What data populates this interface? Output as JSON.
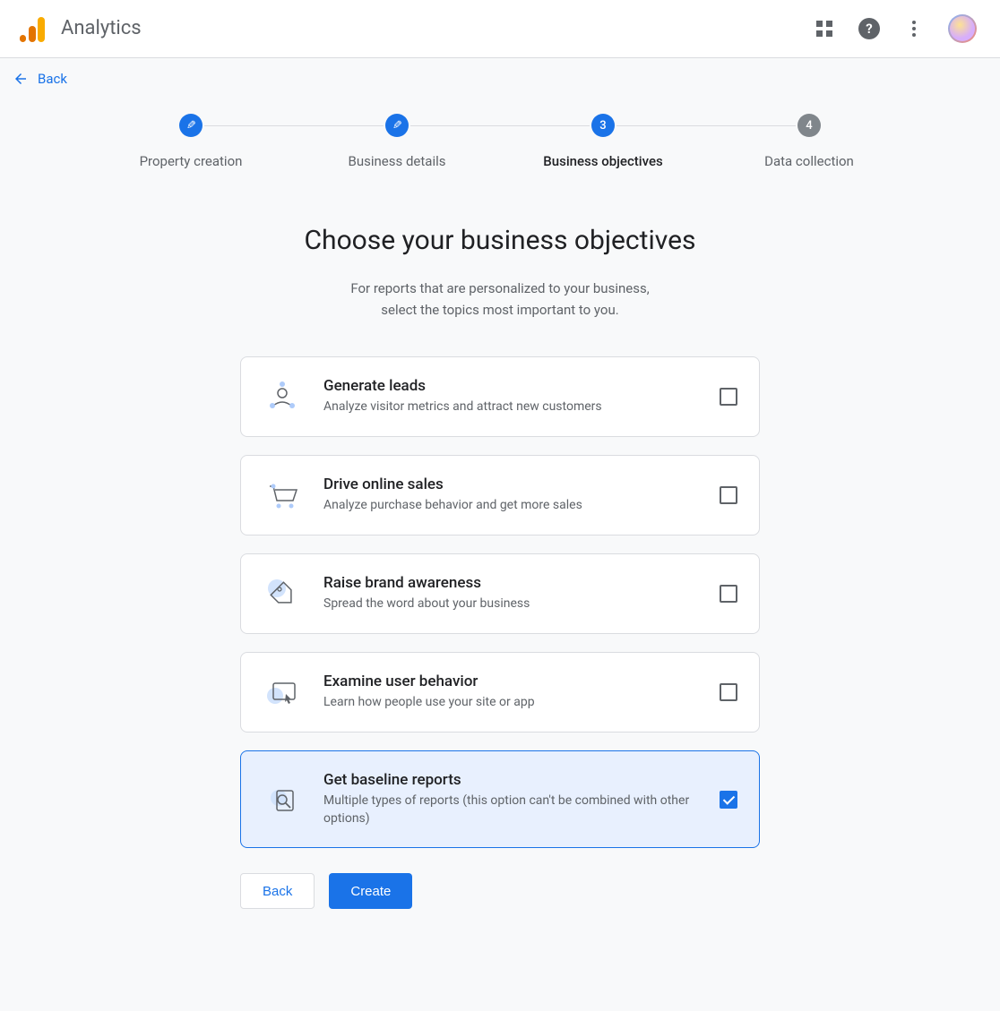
{
  "header": {
    "app_title": "Analytics",
    "back_label": "Back"
  },
  "stepper": {
    "steps": [
      {
        "label": "Property creation",
        "indicator": "✎",
        "state": "done"
      },
      {
        "label": "Business details",
        "indicator": "✎",
        "state": "done"
      },
      {
        "label": "Business objectives",
        "indicator": "3",
        "state": "active"
      },
      {
        "label": "Data collection",
        "indicator": "4",
        "state": "upcoming"
      }
    ]
  },
  "main": {
    "heading": "Choose your business objectives",
    "subtitle_line1": "For reports that are personalized to your business,",
    "subtitle_line2": "select the topics most important to you."
  },
  "objectives": [
    {
      "key": "generate-leads",
      "title": "Generate leads",
      "desc": "Analyze visitor metrics and attract new customers",
      "checked": false
    },
    {
      "key": "drive-online-sales",
      "title": "Drive online sales",
      "desc": "Analyze purchase behavior and get more sales",
      "checked": false
    },
    {
      "key": "raise-brand-awareness",
      "title": "Raise brand awareness",
      "desc": "Spread the word about your business",
      "checked": false
    },
    {
      "key": "examine-user-behavior",
      "title": "Examine user behavior",
      "desc": "Learn how people use your site or app",
      "checked": false
    },
    {
      "key": "baseline-reports",
      "title": "Get baseline reports",
      "desc": "Multiple types of reports (this option can't be combined with other options)",
      "checked": true
    }
  ],
  "actions": {
    "back": "Back",
    "create": "Create"
  },
  "colors": {
    "primary": "#1a73e8",
    "grey": "#5f6368",
    "selected_bg": "#e8f0fe"
  }
}
